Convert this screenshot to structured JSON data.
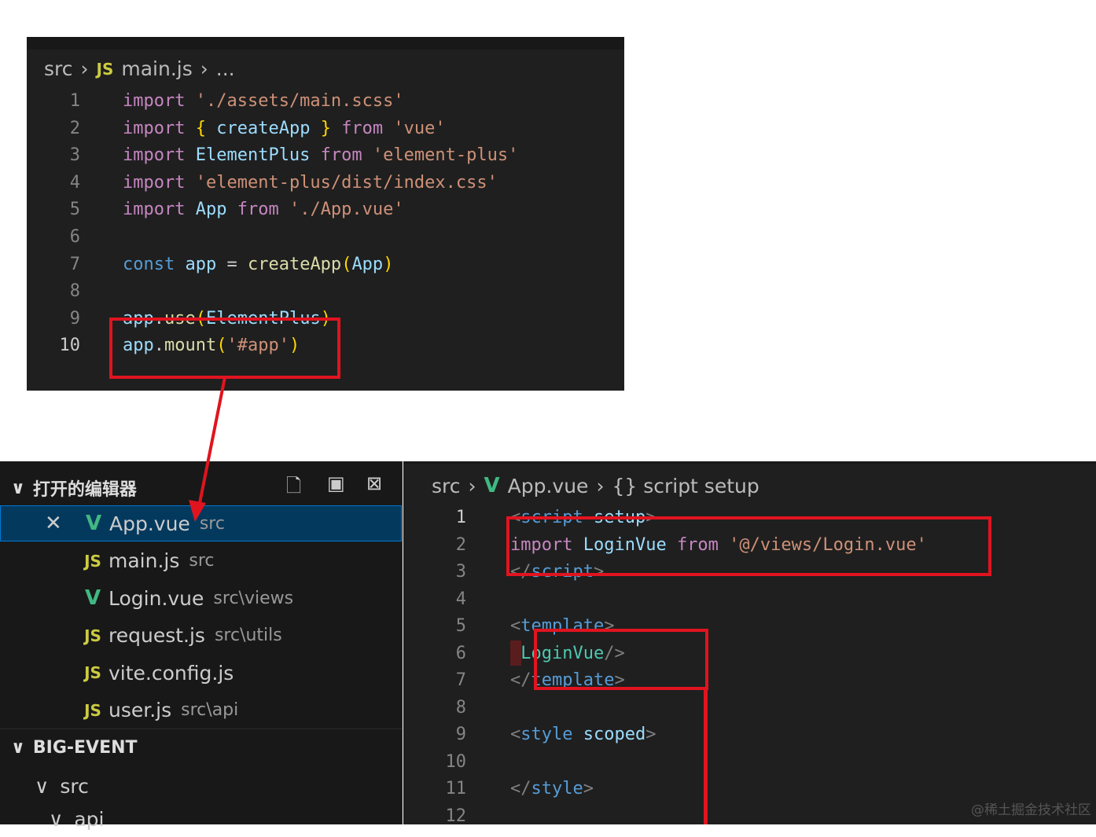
{
  "top_editor": {
    "breadcrumb": {
      "folder": "src",
      "file_icon": "JS",
      "file": "main.js",
      "more": "..."
    },
    "lines": [
      [
        [
          "import",
          "k"
        ],
        [
          " ",
          "p"
        ],
        [
          "'./assets/main.scss'",
          "s"
        ]
      ],
      [
        [
          "import",
          "k"
        ],
        [
          " ",
          "p"
        ],
        [
          "{",
          "b"
        ],
        [
          " createApp ",
          "v"
        ],
        [
          "}",
          "b"
        ],
        [
          " ",
          "p"
        ],
        [
          "from",
          "k"
        ],
        [
          " ",
          "p"
        ],
        [
          "'vue'",
          "s"
        ]
      ],
      [
        [
          "import",
          "k"
        ],
        [
          " ElementPlus ",
          "v"
        ],
        [
          "from",
          "k"
        ],
        [
          " ",
          "p"
        ],
        [
          "'element-plus'",
          "s"
        ]
      ],
      [
        [
          "import",
          "k"
        ],
        [
          " ",
          "p"
        ],
        [
          "'element-plus/dist/index.css'",
          "s"
        ]
      ],
      [
        [
          "import",
          "k"
        ],
        [
          " App ",
          "v"
        ],
        [
          "from",
          "k"
        ],
        [
          " ",
          "p"
        ],
        [
          "'./App.vue'",
          "s"
        ]
      ],
      [],
      [
        [
          "const",
          "d"
        ],
        [
          " app ",
          "v"
        ],
        [
          "= ",
          "p"
        ],
        [
          "createApp",
          "f"
        ],
        [
          "(",
          "b"
        ],
        [
          "App",
          "v"
        ],
        [
          ")",
          "b"
        ]
      ],
      [],
      [
        [
          "app",
          "v"
        ],
        [
          ".",
          "p"
        ],
        [
          "use",
          "f"
        ],
        [
          "(",
          "b"
        ],
        [
          "ElementPlus",
          "v"
        ],
        [
          ")",
          "b"
        ]
      ],
      [
        [
          "app",
          "v"
        ],
        [
          ".",
          "p"
        ],
        [
          "mount",
          "f"
        ],
        [
          "(",
          "b"
        ],
        [
          "'#app'",
          "s"
        ],
        [
          ")",
          "b"
        ]
      ]
    ],
    "active_line": 10
  },
  "sidebar": {
    "open_editors_title": "打开的编辑器",
    "open_editors": [
      {
        "icon": "vue",
        "name": "App.vue",
        "path": "src",
        "active": true
      },
      {
        "icon": "JS",
        "name": "main.js",
        "path": "src"
      },
      {
        "icon": "vue",
        "name": "Login.vue",
        "path": "src\\views"
      },
      {
        "icon": "JS",
        "name": "request.js",
        "path": "src\\utils"
      },
      {
        "icon": "JS",
        "name": "vite.config.js",
        "path": ""
      },
      {
        "icon": "JS",
        "name": "user.js",
        "path": "src\\api"
      }
    ],
    "project_title": "BIG-EVENT",
    "tree": [
      "src",
      "api"
    ]
  },
  "bottom_editor": {
    "breadcrumb": {
      "folder": "src",
      "file": "App.vue",
      "symbol": "{} script setup"
    },
    "lines": [
      [
        [
          "<",
          "g"
        ],
        [
          "script",
          "t"
        ],
        [
          " ",
          "p"
        ],
        [
          "setup",
          "v"
        ],
        [
          ">",
          "g"
        ]
      ],
      [
        [
          "import",
          "k"
        ],
        [
          " LoginVue ",
          "v"
        ],
        [
          "from",
          "k"
        ],
        [
          " ",
          "p"
        ],
        [
          "'@/views/Login.vue'",
          "s"
        ]
      ],
      [
        [
          "</",
          "g"
        ],
        [
          "script",
          "t"
        ],
        [
          ">",
          "g"
        ]
      ],
      [],
      [
        [
          "<",
          "g"
        ],
        [
          "template",
          "t"
        ],
        [
          ">",
          "g"
        ]
      ],
      [
        [
          "<",
          "g"
        ],
        [
          "LoginVue",
          "c"
        ],
        [
          "/>",
          "g"
        ]
      ],
      [
        [
          "</",
          "g"
        ],
        [
          "template",
          "t"
        ],
        [
          ">",
          "g"
        ]
      ],
      [],
      [
        [
          "<",
          "g"
        ],
        [
          "style",
          "t"
        ],
        [
          " ",
          "p"
        ],
        [
          "scoped",
          "v"
        ],
        [
          ">",
          "g"
        ]
      ],
      [],
      [
        [
          "</",
          "g"
        ],
        [
          "style",
          "t"
        ],
        [
          ">",
          "g"
        ]
      ],
      []
    ],
    "active_line": 1
  },
  "watermark": "@稀土掘金技术社区"
}
